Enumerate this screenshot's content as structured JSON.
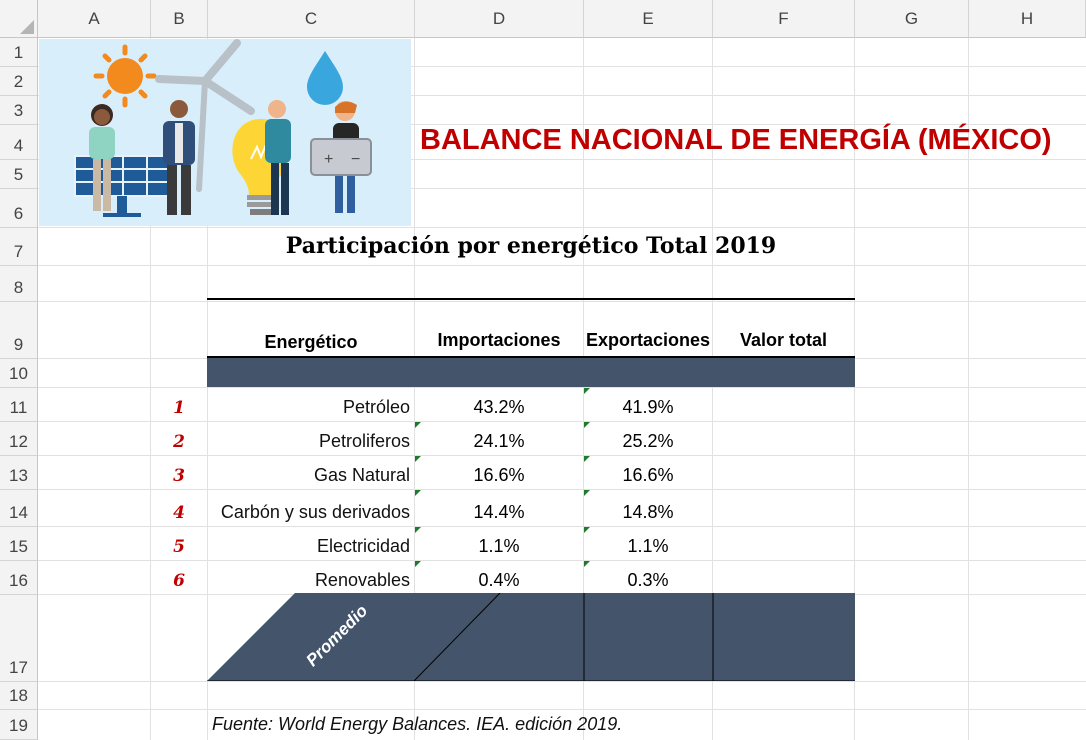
{
  "columns": [
    "A",
    "B",
    "C",
    "D",
    "E",
    "F",
    "G",
    "H"
  ],
  "rows": [
    "1",
    "2",
    "3",
    "4",
    "5",
    "6",
    "7",
    "8",
    "9",
    "10",
    "11",
    "12",
    "13",
    "14",
    "15",
    "16",
    "17",
    "18",
    "19"
  ],
  "title": "BALANCE NACIONAL DE ENERGÍA (MÉXICO)",
  "subtitle": "Participación por energético Total 2019",
  "table": {
    "headers": {
      "energetico": "Energético",
      "importaciones": "Importaciones",
      "exportaciones": "Exportaciones",
      "valor_total": "Valor total"
    },
    "rows": [
      {
        "n": "1",
        "name": "Petróleo",
        "imp": "43.2%",
        "exp": "41.9%"
      },
      {
        "n": "2",
        "name": "Petroliferos",
        "imp": "24.1%",
        "exp": "25.2%"
      },
      {
        "n": "3",
        "name": "Gas Natural",
        "imp": "16.6%",
        "exp": "16.6%"
      },
      {
        "n": "4",
        "name": "Carbón y sus derivados",
        "imp": "14.4%",
        "exp": "14.8%"
      },
      {
        "n": "5",
        "name": "Electricidad",
        "imp": "1.1%",
        "exp": "1.1%"
      },
      {
        "n": "6",
        "name": "Renovables",
        "imp": "0.4%",
        "exp": "0.3%"
      }
    ],
    "promedio_label": "Promedio"
  },
  "source": "Fuente:  World Energy Balances. IEA. edición 2019.",
  "colors": {
    "title_red": "#c00000",
    "band_slate": "#44546a",
    "index_red": "#c00000",
    "illustration_bg": "#d9eefb"
  }
}
